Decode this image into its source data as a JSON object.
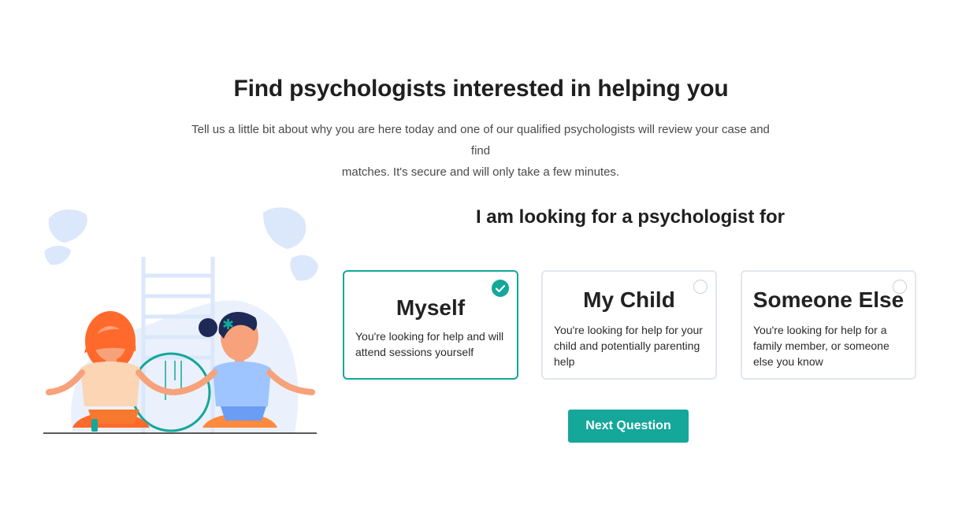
{
  "header": {
    "title": "Find psychologists interested in helping you",
    "subtitle_line1": "Tell us a little bit about why you are here today and one of our qualified psychologists will review your case and find",
    "subtitle_line2": "matches. It's secure and will only take a few minutes."
  },
  "question": {
    "title": "I am looking for a psychologist for",
    "options": [
      {
        "label": "Myself",
        "description": "You're looking for help and will attend sessions yourself",
        "selected": true
      },
      {
        "label": "My Child",
        "description": "You're looking for help for your child and potentially parenting help",
        "selected": false
      },
      {
        "label": "Someone Else",
        "description": "You're looking for help for a family member, or someone else you know",
        "selected": false
      }
    ]
  },
  "actions": {
    "next_label": "Next Question"
  },
  "colors": {
    "accent": "#14a79a",
    "card_border": "#e2e7ee",
    "leaf": "#dbe7fa"
  },
  "illustration": {
    "icon": "meditation-illustration"
  }
}
